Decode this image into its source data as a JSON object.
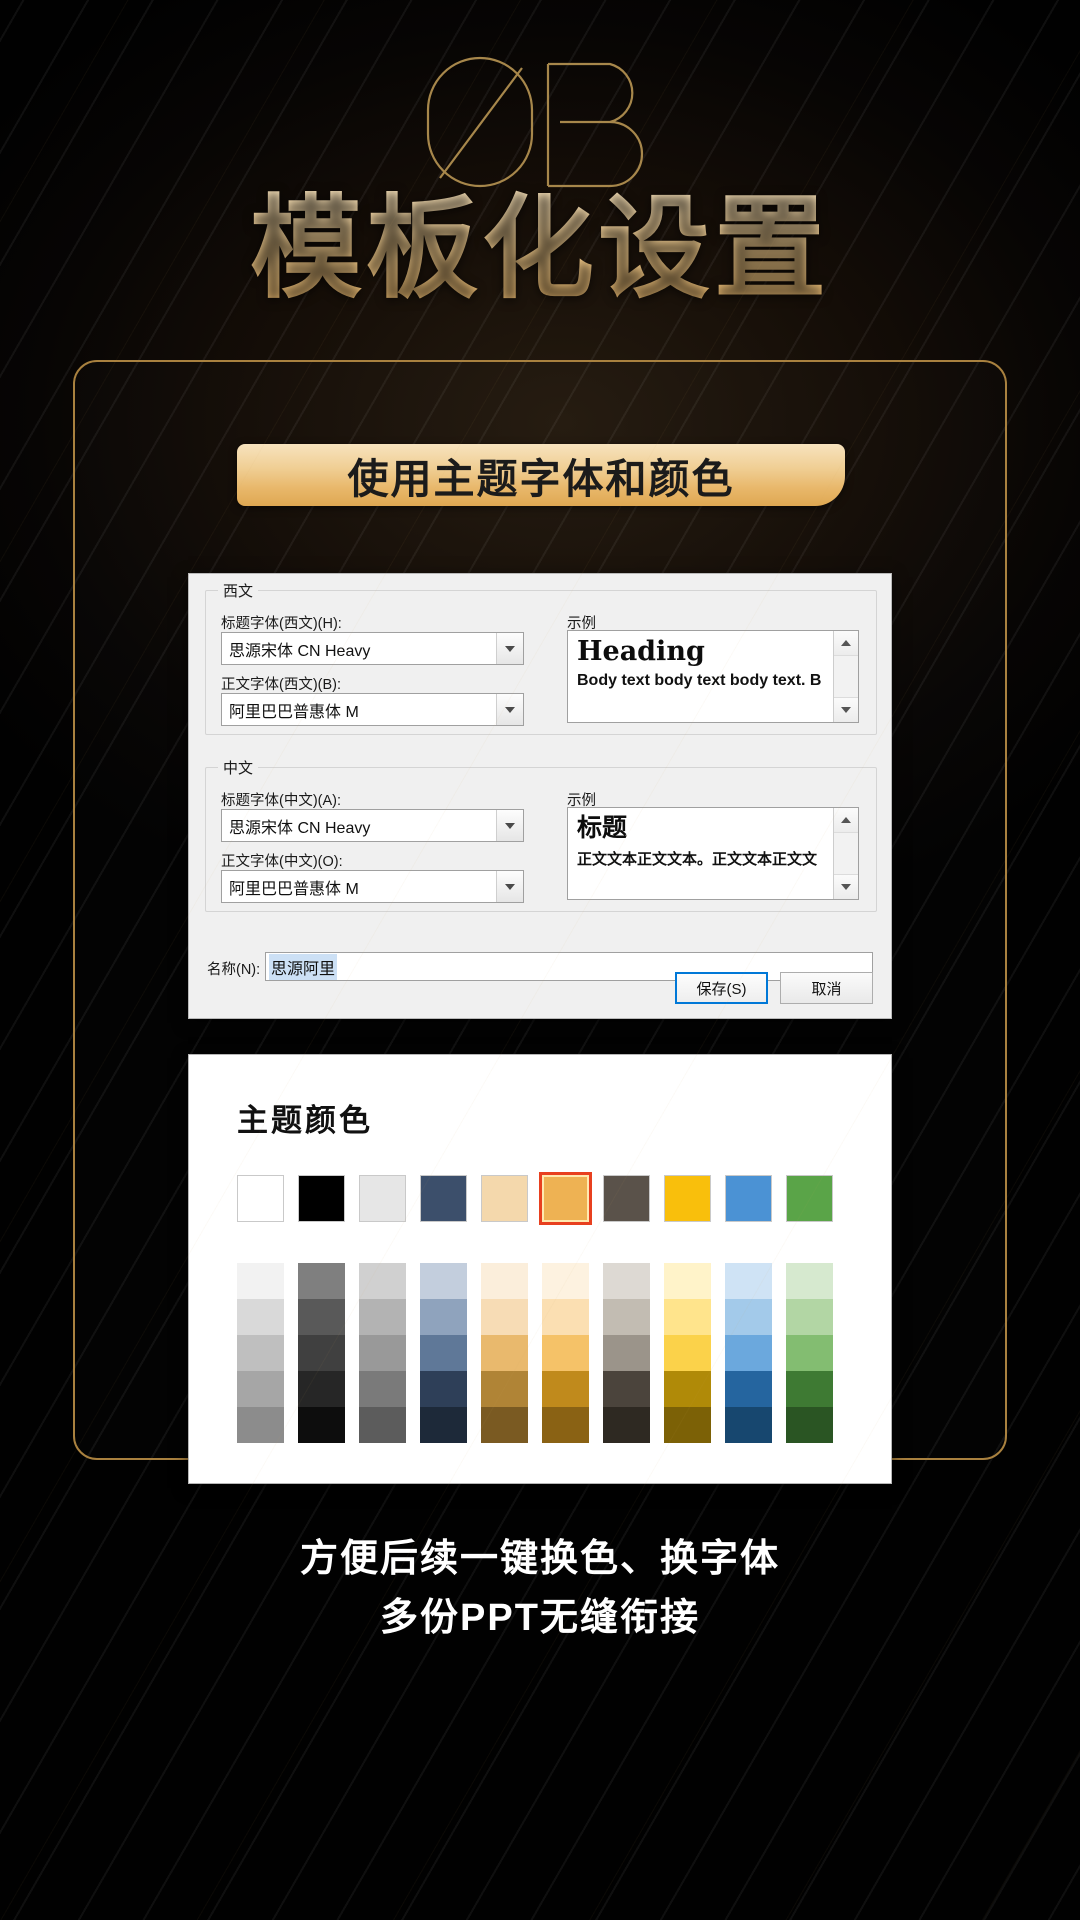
{
  "section": {
    "number": "03",
    "title": "模板化设置"
  },
  "ribbon": {
    "label": "使用主题字体和颜色"
  },
  "dialog": {
    "western": {
      "legend": "西文",
      "heading_label": "标题字体(西文)(H):",
      "heading_value": "思源宋体 CN Heavy",
      "body_label": "正文字体(西文)(B):",
      "body_value": "阿里巴巴普惠体 M",
      "sample_label": "示例",
      "sample_heading": "Heading",
      "sample_body": "Body text body text body text. B"
    },
    "chinese": {
      "legend": "中文",
      "heading_label": "标题字体(中文)(A):",
      "heading_value": "思源宋体 CN Heavy",
      "body_label": "正文字体(中文)(O):",
      "body_value": "阿里巴巴普惠体 M",
      "sample_label": "示例",
      "sample_heading": "标题",
      "sample_body": "正文文本正文文本。正文文本正文文"
    },
    "name_label": "名称(N):",
    "name_value": "思源阿里",
    "save_label": "保存(S)",
    "cancel_label": "取消"
  },
  "palette": {
    "title": "主题颜色",
    "selected_index": 5,
    "base_colors": [
      "#ffffff",
      "#000000",
      "#e6e6e6",
      "#3c4f6b",
      "#f4d8ac",
      "#eeb253",
      "#5a524a",
      "#f9bf0c",
      "#4b92d4",
      "#5aa448"
    ],
    "tints": [
      [
        "#f2f2f2",
        "#d9d9d9",
        "#bfbfbf",
        "#a6a6a6",
        "#8c8c8c"
      ],
      [
        "#7f7f7f",
        "#595959",
        "#404040",
        "#262626",
        "#0d0d0d"
      ],
      [
        "#d0d0d0",
        "#b3b3b3",
        "#999999",
        "#7a7a7a",
        "#5c5c5c"
      ],
      [
        "#c3cedd",
        "#8fa3bd",
        "#5f7898",
        "#2e3f58",
        "#1d2939"
      ],
      [
        "#fbeedb",
        "#f7dcb5",
        "#e9b96d",
        "#b08436",
        "#7a5a22"
      ],
      [
        "#fdf2e0",
        "#fbdfb2",
        "#f5c268",
        "#c08a1c",
        "#8a6214"
      ],
      [
        "#ddd9d3",
        "#c2bcb2",
        "#9b948a",
        "#4b443c",
        "#2e2922"
      ],
      [
        "#fff3c9",
        "#ffe48c",
        "#fbd24a",
        "#b08a08",
        "#7c6106"
      ],
      [
        "#cfe3f5",
        "#a3caea",
        "#6ba8dd",
        "#25659f",
        "#17476f"
      ],
      [
        "#d6e9cf",
        "#b2d6a4",
        "#83bd71",
        "#3e7a33",
        "#2a5523"
      ]
    ]
  },
  "caption": {
    "line1": "方便后续一键换色、换字体",
    "line2": "多份PPT无缝衔接"
  }
}
